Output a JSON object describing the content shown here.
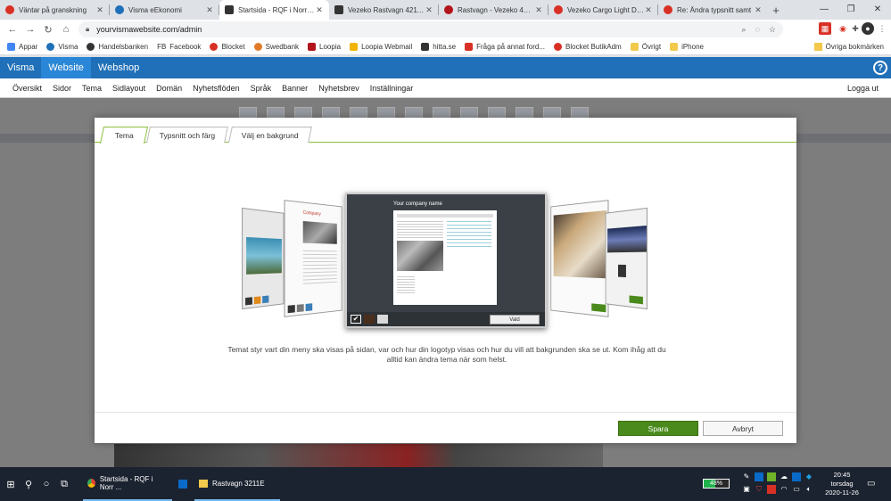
{
  "browser": {
    "tabs": [
      {
        "title": "Väntar på granskning",
        "color": "#d93025"
      },
      {
        "title": "Visma eEkonomi",
        "color": "#1f70b8"
      },
      {
        "title": "Startsida - RQF i Norr AB",
        "color": "#333333",
        "active": true
      },
      {
        "title": "Vezeko Rastvagn 4211E",
        "color": "#333333"
      },
      {
        "title": "Rastvagn - Vezeko 4211",
        "color": "#b3141a"
      },
      {
        "title": "Vezeko Cargo Light D 20",
        "color": "#d93025"
      },
      {
        "title": "Re: Ändra typsnitt samt",
        "color": "#d93025"
      }
    ],
    "url": "yourvismawebsite.com/admin",
    "bookmarks": [
      {
        "label": "Appar",
        "color": "#4285f4"
      },
      {
        "label": "Visma",
        "color": "#1f70b8"
      },
      {
        "label": "Handelsbanken",
        "color": "#333333"
      },
      {
        "label": "Facebook",
        "prefix": "FB",
        "color": "#333333"
      },
      {
        "label": "Blocket",
        "color": "#d93025"
      },
      {
        "label": "Swedbank",
        "color": "#e07b2a"
      },
      {
        "label": "Loopia",
        "color": "#b3141a"
      },
      {
        "label": "Loopia Webmail",
        "color": "#f0b400"
      },
      {
        "label": "hitta.se",
        "color": "#333333"
      },
      {
        "label": "Fråga på annat ford...",
        "color": "#d93025"
      },
      {
        "label": "Blocket ButikAdm",
        "color": "#d93025"
      },
      {
        "label": "Övrigt",
        "color": "#f2c94c"
      },
      {
        "label": "iPhone",
        "color": "#f2c94c"
      }
    ],
    "other_bookmarks": "Övriga bokmärken"
  },
  "app": {
    "top_tabs": [
      "Visma",
      "Website",
      "Webshop"
    ],
    "active_top_tab": "Website",
    "menu": [
      "Översikt",
      "Sidor",
      "Tema",
      "Sidlayout",
      "Domän",
      "Nyhetsflöden",
      "Språk",
      "Banner",
      "Nyhetsbrev",
      "Inställningar"
    ],
    "logout": "Logga ut"
  },
  "modal": {
    "tabs": [
      "Tema",
      "Typsnitt och färg",
      "Välj en bakgrund"
    ],
    "active_tab": "Tema",
    "preview_company_name": "Your company name",
    "small_card_title": "Company",
    "choose_button": "Vald",
    "swatches": [
      "#2b2b2b",
      "#4a2e1c",
      "#d9d9d9"
    ],
    "description": "Temat styr vart din meny ska visas på sidan, var och hur din logotyp visas och hur du vill att bakgrunden ska se ut. Kom ihåg att du alltid kan ändra tema när som helst.",
    "save_label": "Spara",
    "cancel_label": "Avbryt"
  },
  "taskbar": {
    "apps": [
      {
        "title": "Startsida - RQF i Norr ..."
      },
      {
        "title": "Rastvagn 3211E"
      }
    ],
    "battery_level": 0.48,
    "battery_label": "48%",
    "time": "20:45",
    "day": "torsdag",
    "date": "2020-11-26"
  }
}
